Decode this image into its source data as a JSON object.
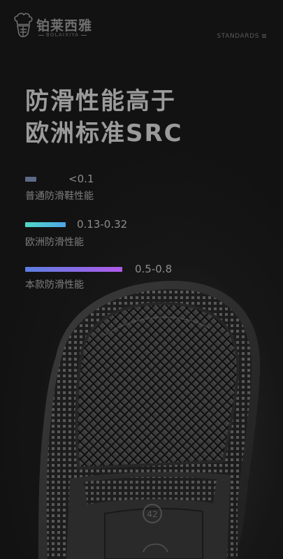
{
  "header": {
    "brand_cn": "铂莱西雅",
    "brand_en": "BOLAIXIYA",
    "nav_label": "STANDARDS"
  },
  "headline": {
    "line1": "防滑性能高于",
    "line2": "欧洲标准SRC"
  },
  "comparisons": [
    {
      "value": "<0.1",
      "label": "普通防滑鞋性能",
      "bar_colors": [
        "#5b6a86",
        "#5b6a86"
      ]
    },
    {
      "value": "0.13-0.32",
      "label": "欧洲防滑性能",
      "bar_colors": [
        "#4fd9c8",
        "#4fa6e6"
      ]
    },
    {
      "value": "0.5-0.8",
      "label": "本款防滑性能",
      "bar_colors": [
        "#5b7fe0",
        "#b05ae8"
      ]
    }
  ],
  "sole": {
    "size_mark": "42"
  },
  "colors": {
    "background": "#131313",
    "headline": "#9b9b9b"
  }
}
